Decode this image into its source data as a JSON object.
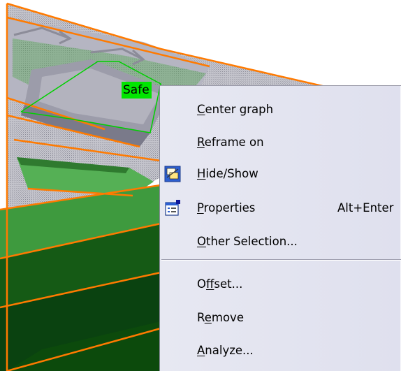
{
  "viewport": {
    "label": "Safe",
    "colors": {
      "orange": "#ff7a00",
      "gray_surface": "#b8b8c4",
      "green_light": "#3fa83f",
      "green_dark": "#0c4a0c",
      "selection": "#00e600"
    }
  },
  "context_menu": {
    "items": [
      {
        "pre": "",
        "u": "C",
        "post": "enter graph",
        "icon": null,
        "accel": ""
      },
      {
        "pre": "",
        "u": "R",
        "post": "eframe on",
        "icon": null,
        "accel": ""
      },
      {
        "pre": "",
        "u": "H",
        "post": "ide/Show",
        "icon": "hide-show-icon",
        "accel": ""
      },
      {
        "pre": "",
        "u": "P",
        "post": "roperties",
        "icon": "properties-icon",
        "accel": "Alt+Enter"
      },
      {
        "pre": "",
        "u": "O",
        "post": "ther Selection...",
        "icon": null,
        "accel": ""
      },
      {
        "pre": "O",
        "u": "f",
        "post": "fset...",
        "icon": null,
        "accel": ""
      },
      {
        "pre": "R",
        "u": "e",
        "post": "move",
        "icon": null,
        "accel": ""
      },
      {
        "pre": "",
        "u": "A",
        "post": "nalyze...",
        "icon": null,
        "accel": ""
      }
    ]
  }
}
